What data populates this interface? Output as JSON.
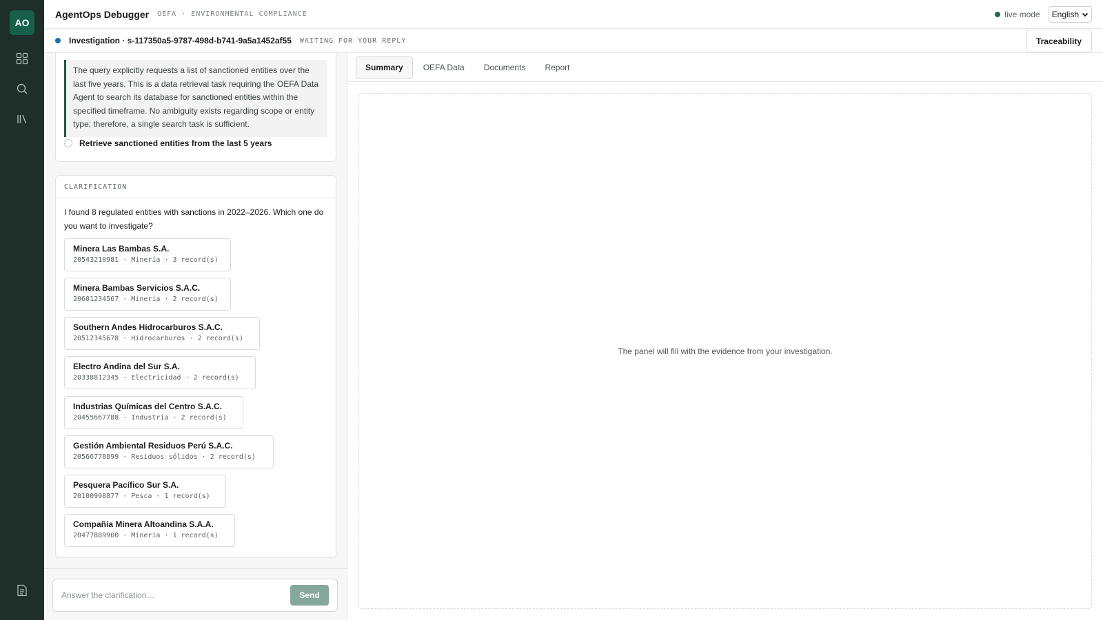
{
  "rail": {
    "logo_text": "AO",
    "icons": [
      "dashboard-icon",
      "search-icon",
      "library-icon",
      "document-icon"
    ]
  },
  "header": {
    "title": "AgentOps Debugger",
    "subtitle": "OEFA · ENVIRONMENTAL COMPLIANCE",
    "live_label": "live mode",
    "language": "English"
  },
  "subheader": {
    "investigation": "Investigation · s-117350a5-9787-498d-b741-9a5a1452af55",
    "status": "WAITING FOR YOUR REPLY",
    "traceability_label": "Traceability"
  },
  "plan": {
    "reasoning": "The query explicitly requests a list of sanctioned entities over the last five years. This is a data retrieval task requiring the OEFA Data Agent to search its database for sanctioned entities within the specified timeframe. No ambiguity exists regarding scope or entity type; therefore, a single search task is sufficient.",
    "task": "Retrieve sanctioned entities from the last 5 years"
  },
  "clarification": {
    "heading": "CLARIFICATION",
    "question": "I found 8 regulated entities with sanctions in 2022–2026. Which one do you want to investigate?",
    "entities": [
      {
        "name": "Minera Las Bambas S.A.",
        "meta": "20543210981 · Minería · 3 record(s)"
      },
      {
        "name": "Minera Bambas Servicios S.A.C.",
        "meta": "20601234567 · Minería · 2 record(s)"
      },
      {
        "name": "Southern Andes Hidrocarburos S.A.C.",
        "meta": "20512345678 · Hidrocarburos · 2 record(s)"
      },
      {
        "name": "Electro Andina del Sur S.A.",
        "meta": "20338812345 · Electricidad · 2 record(s)"
      },
      {
        "name": "Industrias Químicas del Centro S.A.C.",
        "meta": "20455667788 · Industria · 2 record(s)"
      },
      {
        "name": "Gestión Ambiental Residuos Perú S.A.C.",
        "meta": "20566778899 · Residuos sólidos · 2 record(s)"
      },
      {
        "name": "Pesquera Pacífico Sur S.A.",
        "meta": "20100998877 · Pesca · 1 record(s)"
      },
      {
        "name": "Compañía Minera Altoandina S.A.A.",
        "meta": "20477889900 · Minería · 1 record(s)"
      }
    ]
  },
  "composer": {
    "placeholder": "Answer the clarification…",
    "send_label": "Send"
  },
  "panel": {
    "tabs": [
      "Summary",
      "OEFA Data",
      "Documents",
      "Report"
    ],
    "active_tab": "Summary",
    "empty_message": "The panel will fill with the evidence from your investigation."
  },
  "colors": {
    "rail": "#1e2f2a",
    "accent": "#16604a",
    "status_dot": "#1f6ea8",
    "send_button": "#86a89a"
  }
}
